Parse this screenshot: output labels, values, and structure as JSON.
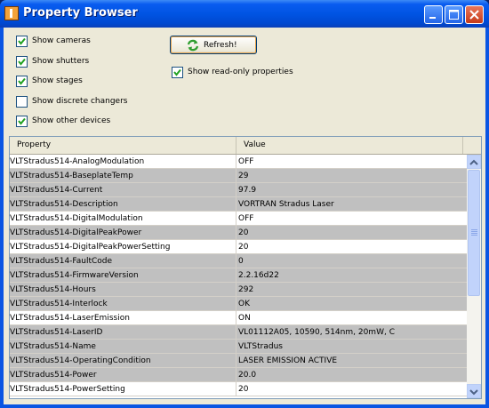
{
  "window": {
    "title": "Property Browser",
    "icon": "app-icon",
    "controls": [
      "minimize-icon",
      "maximize-icon",
      "close-icon"
    ]
  },
  "options": {
    "show_cameras": {
      "label": "Show cameras",
      "checked": true
    },
    "show_shutters": {
      "label": "Show shutters",
      "checked": true
    },
    "show_stages": {
      "label": "Show stages",
      "checked": true
    },
    "show_discrete_changers": {
      "label": "Show discrete changers",
      "checked": false
    },
    "show_other_devices": {
      "label": "Show other devices",
      "checked": true
    },
    "show_readonly": {
      "label": "Show read-only properties",
      "checked": true
    }
  },
  "refresh_button": {
    "label": "Refresh!",
    "icon": "refresh-icon"
  },
  "table": {
    "headers": {
      "property": "Property",
      "value": "Value"
    },
    "rows": [
      {
        "property": "VLTStradus514-AnalogModulation",
        "value": "OFF",
        "readonly": false
      },
      {
        "property": "VLTStradus514-BaseplateTemp",
        "value": " 29",
        "readonly": true
      },
      {
        "property": "VLTStradus514-Current",
        "value": "97.9",
        "readonly": true
      },
      {
        "property": "VLTStradus514-Description",
        "value": "VORTRAN Stradus Laser",
        "readonly": true
      },
      {
        "property": "VLTStradus514-DigitalModulation",
        "value": "OFF",
        "readonly": false
      },
      {
        "property": "VLTStradus514-DigitalPeakPower",
        "value": "20",
        "readonly": true
      },
      {
        "property": "VLTStradus514-DigitalPeakPowerSetting",
        "value": "20",
        "readonly": false
      },
      {
        "property": "VLTStradus514-FaultCode",
        "value": "0",
        "readonly": true
      },
      {
        "property": "VLTStradus514-FirmwareVersion",
        "value": "2.2.16d22",
        "readonly": true
      },
      {
        "property": "VLTStradus514-Hours",
        "value": "292",
        "readonly": true
      },
      {
        "property": "VLTStradus514-Interlock",
        "value": "OK",
        "readonly": true
      },
      {
        "property": "VLTStradus514-LaserEmission",
        "value": "ON",
        "readonly": false
      },
      {
        "property": "VLTStradus514-LaserID",
        "value": "VL01112A05, 10590, 514nm, 20mW, C",
        "readonly": true
      },
      {
        "property": "VLTStradus514-Name",
        "value": "VLTStradus",
        "readonly": true
      },
      {
        "property": "VLTStradus514-OperatingCondition",
        "value": "LASER EMISSION ACTIVE",
        "readonly": true
      },
      {
        "property": "VLTStradus514-Power",
        "value": "20.0",
        "readonly": true
      },
      {
        "property": "VLTStradus514-PowerSetting",
        "value": "20",
        "readonly": false
      }
    ]
  },
  "colors": {
    "readonly_row": "#c0c0c0",
    "editable_row": "#ffffff",
    "titlebar": "#0054e3"
  }
}
